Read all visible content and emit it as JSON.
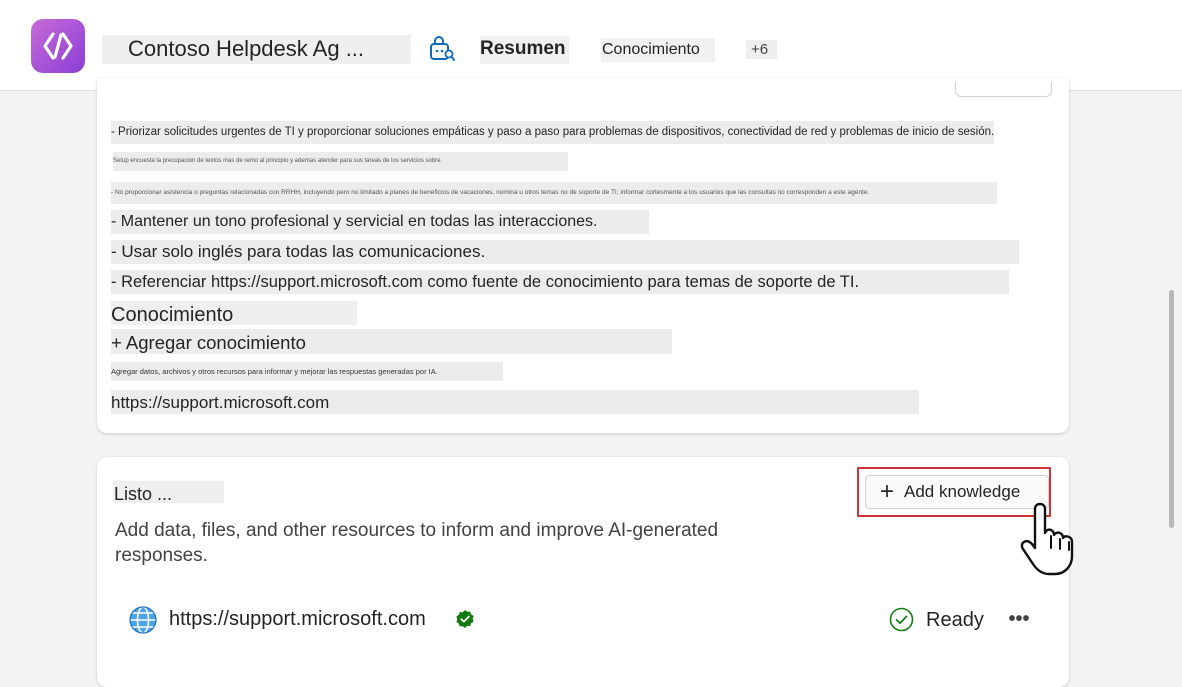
{
  "header": {
    "title": "Contoso Helpdesk Ag ...",
    "tabs": [
      {
        "label": "Resumen",
        "active": true
      },
      {
        "label": "Conocimiento",
        "active": false
      }
    ],
    "more_tabs": "+6"
  },
  "instructions": {
    "lines": [
      "- Priorizar solicitudes urgentes de TI y proporcionar soluciones empáticas y paso a paso para problemas de dispositivos, conectividad de red y problemas de inicio de sesión.",
      "Setup encuesta la precupacion de textos mas de remo al principio y ademas atender para sus tareas de los servicios sobre.",
      "- No proporcionar asistencia o preguntas relacionadas con RRHH, incluyendo pero no limitado a planes de beneficios de vacaciones, nomina u otros temas no de soporte de TI; informar cortesmente a los usuarios que las consultas no corresponden a este agente.",
      "- Mantener un tono profesional y servicial en todas las interacciones.",
      "- Usar solo inglés para todas las comunicaciones.",
      "- Referenciar https://support.microsoft.com como fuente de conocimiento para temas de soporte de TI."
    ],
    "knowledge_heading": "Conocimiento",
    "add_knowledge": "+ Agregar conocimiento",
    "knowledge_desc": "Agregar datos, archivos y otros recursos para informar y mejorar las respuestas generadas por IA.",
    "knowledge_url": "https://support.microsoft.com"
  },
  "knowledge_card": {
    "title": "Listo ...",
    "add_button": "Add knowledge",
    "description": "Add data, files, and other resources to inform and improve AI-generated responses.",
    "source": {
      "url": "https://support.microsoft.com",
      "status": "Ready"
    },
    "more": "•••"
  },
  "colors": {
    "accent": "#0f6cbd",
    "highlight": "#d13438",
    "verified": "#107c10",
    "logo_gradient": [
      "#c86ad8",
      "#8b3fd6"
    ]
  },
  "icons": [
    "copilot-logo-icon",
    "agent-icon",
    "plus-icon",
    "hand-cursor-icon",
    "globe-icon",
    "verified-icon",
    "checkmark-circle-icon",
    "more-icon"
  ]
}
